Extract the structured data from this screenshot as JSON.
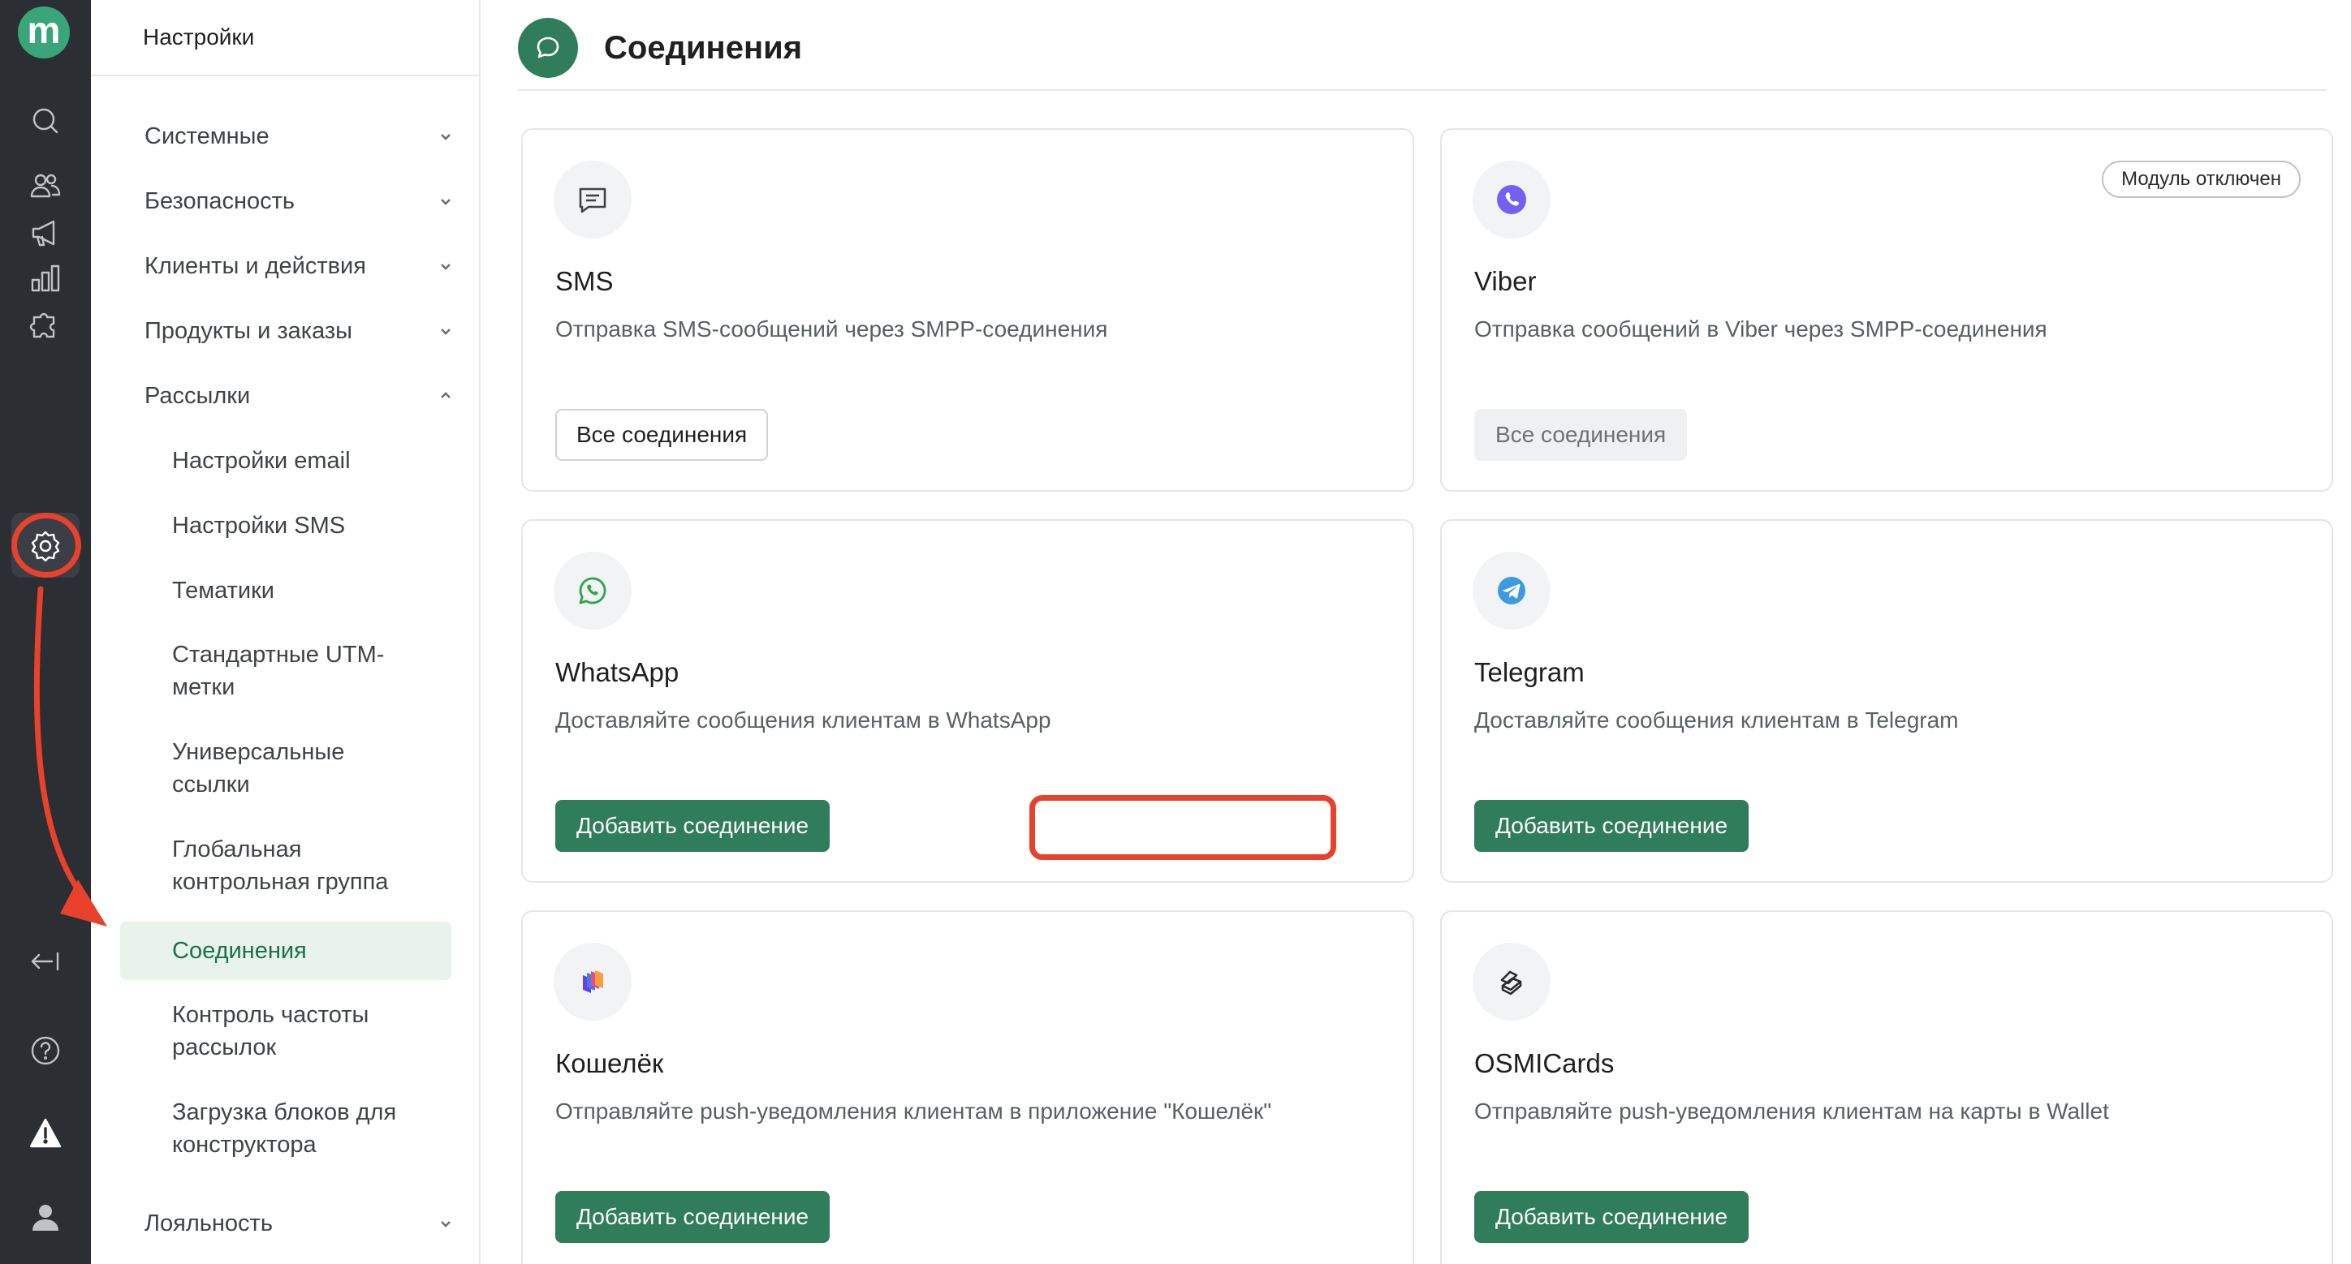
{
  "brand": {
    "logo_letter": "m",
    "accent": "#2f7d5a",
    "highlight": "#e8412c"
  },
  "rail": {
    "items": [
      {
        "icon": "search-icon"
      },
      {
        "icon": "users-icon"
      },
      {
        "icon": "megaphone-icon"
      },
      {
        "icon": "chart-icon"
      },
      {
        "icon": "puzzle-icon"
      },
      {
        "icon": "gear-icon",
        "active": true
      },
      {
        "icon": "collapse-icon"
      },
      {
        "icon": "help-icon"
      },
      {
        "icon": "warning-icon"
      },
      {
        "icon": "user-icon"
      }
    ]
  },
  "sidebar": {
    "title": "Настройки",
    "groups": [
      {
        "label": "Системные",
        "expanded": false
      },
      {
        "label": "Безопасность",
        "expanded": false
      },
      {
        "label": "Клиенты и действия",
        "expanded": false
      },
      {
        "label": "Продукты и заказы",
        "expanded": false
      },
      {
        "label": "Рассылки",
        "expanded": true
      },
      {
        "label": "Лояльность",
        "expanded": false
      }
    ],
    "subitems": [
      {
        "line1": "Настройки email",
        "line2": ""
      },
      {
        "line1": "Настройки SMS",
        "line2": ""
      },
      {
        "line1": "Тематики",
        "line2": ""
      },
      {
        "line1": "Стандартные UTM-",
        "line2": "метки"
      },
      {
        "line1": "Универсальные",
        "line2": "ссылки"
      },
      {
        "line1": "Глобальная",
        "line2": "контрольная группа"
      },
      {
        "line1": "Соединения",
        "line2": "",
        "active": true
      },
      {
        "line1": "Контроль частоты",
        "line2": "рассылок"
      },
      {
        "line1": "Загрузка блоков для",
        "line2": "конструктора"
      }
    ]
  },
  "main": {
    "title": "Соединения",
    "title_icon": "chat-bubble-icon",
    "cards": [
      {
        "icon": "sms-icon",
        "title": "SMS",
        "description": "Отправка SMS-сообщений через SMPP-соединения",
        "button": "Все соединения",
        "button_style": "outline",
        "badge": ""
      },
      {
        "icon": "viber-icon",
        "title": "Viber",
        "description": "Отправка сообщений в Viber через SMPP-соединения",
        "button": "Все соединения",
        "button_style": "disabled",
        "badge": "Модуль отключен"
      },
      {
        "icon": "whatsapp-icon",
        "title": "WhatsApp",
        "description": "Доставляйте сообщения клиентам в WhatsApp",
        "button": "Добавить соединение",
        "button_style": "primary",
        "badge": ""
      },
      {
        "icon": "telegram-icon",
        "title": "Telegram",
        "description": "Доставляйте сообщения клиентам в Telegram",
        "button": "Добавить соединение",
        "button_style": "primary",
        "badge": ""
      },
      {
        "icon": "wallet-icon",
        "title": "Кошелёк",
        "description": "Отправляйте push-уведомления клиентам в приложение \"Кошелёк\"",
        "button": "Добавить соединение",
        "button_style": "primary",
        "badge": ""
      },
      {
        "icon": "osmicards-icon",
        "title": "OSMICards",
        "description": "Отправляйте push-уведомления клиентам на карты в Wallet",
        "button": "Добавить соединение",
        "button_style": "primary",
        "badge": ""
      }
    ]
  }
}
